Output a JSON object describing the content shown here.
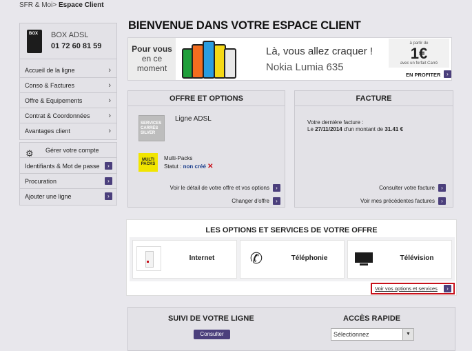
{
  "breadcrumb": {
    "parent": "SFR & Moi",
    "separator": ">",
    "current": "Espace Client"
  },
  "account": {
    "box_label": "BOX",
    "product_name": "BOX ADSL",
    "phone_number": "01 72 60 81 59"
  },
  "sidebar_menu": [
    {
      "label": "Accueil de la ligne"
    },
    {
      "label": "Conso & Factures"
    },
    {
      "label": "Offre & Equipements"
    },
    {
      "label": "Contrat & Coordonnées"
    },
    {
      "label": "Avantages client"
    }
  ],
  "account_management": {
    "title": "Gérer votre compte",
    "items": [
      {
        "label": "Identifiants & Mot de passe"
      },
      {
        "label": "Procuration"
      },
      {
        "label": "Ajouter une ligne"
      }
    ]
  },
  "page_title": "BIENVENUE DANS VOTRE ESPACE CLIENT",
  "banner": {
    "left_line1": "Pour vous",
    "left_line2": "en ce",
    "left_line3": "moment",
    "headline": "Là, vous allez craquer !",
    "product": "Nokia Lumia 635",
    "price_prefix": "à partir de",
    "price": "1€",
    "price_suffix": "avec un forfait Carré",
    "cta": "EN PROFITER",
    "phone_colors": [
      "#1f9f3a",
      "#f26d1f",
      "#f5d916",
      "#2a9de0",
      "#e8e8e8"
    ]
  },
  "offer": {
    "title": "OFFRE ET OPTIONS",
    "logo_text": "SERVICES CARRÉS SILVER",
    "line_name": "Ligne ADSL",
    "multipacks_logo": "MULTI PACKS",
    "multipacks_label": "Multi-Packs",
    "status_label": "Statut :",
    "status_value": "non créé",
    "status_icon": "✕",
    "link_detail": "Voir le détail de votre offre et vos options",
    "link_change": "Changer d'offre"
  },
  "invoice": {
    "title": "FACTURE",
    "last_label": "Votre dernière facture :",
    "date_prefix": "Le",
    "date": "27/11/2014",
    "amount_prefix": "d'un montant de",
    "amount": "31.41 €",
    "link_consult": "Consulter votre facture",
    "link_previous": "Voir mes précédentes factures"
  },
  "options": {
    "title": "LES OPTIONS ET SERVICES DE VOTRE OFFRE",
    "cards": [
      {
        "label": "Internet",
        "icon": "router-icon"
      },
      {
        "label": "Téléphonie",
        "icon": "phone-icon"
      },
      {
        "label": "Télévision",
        "icon": "tv-icon"
      }
    ],
    "link": "Voir vos options et services"
  },
  "follow": {
    "title": "SUIVI DE VOTRE LIGNE",
    "button": "Consulter"
  },
  "quick_access": {
    "title": "ACCÈS RAPIDE",
    "selected": "Sélectionnez"
  },
  "colors": {
    "accent": "#4b3f7c",
    "highlight_border": "#c8101a",
    "status_error": "#c8101a",
    "status_value": "#1c3f8c"
  }
}
